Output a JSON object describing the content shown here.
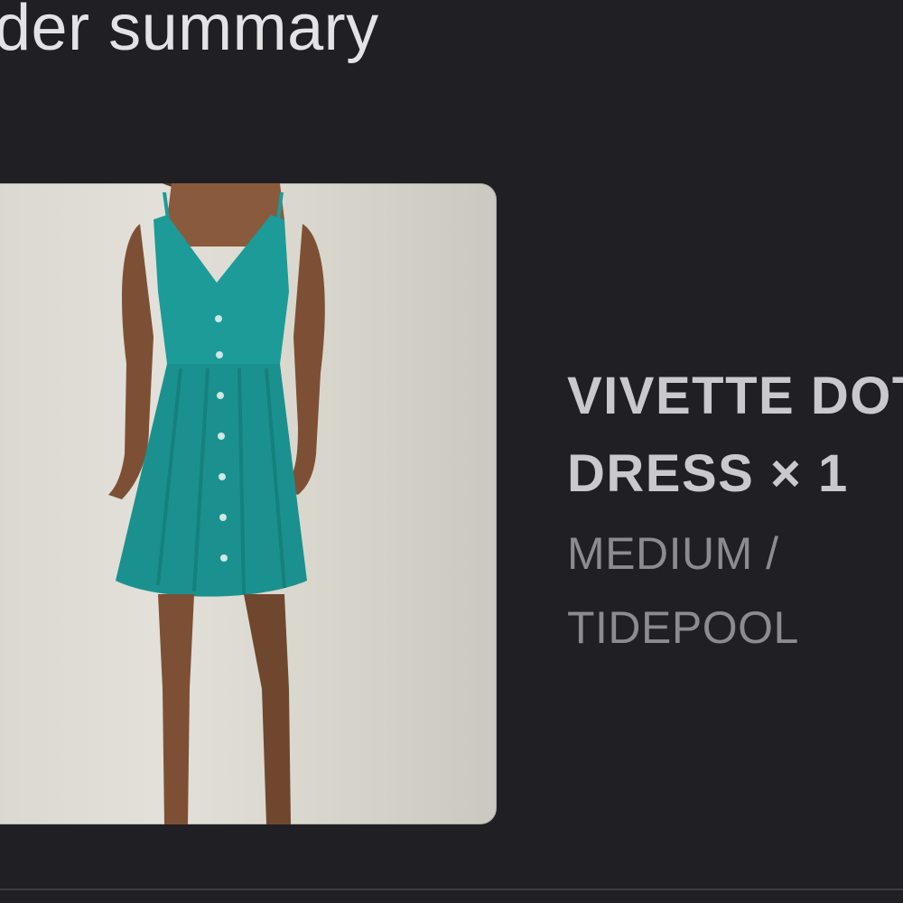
{
  "header": {
    "title": "der summary"
  },
  "line_item": {
    "name_line1": "VIVETTE DOT",
    "name_line2": "DRESS",
    "quantity_text": "× 1",
    "variant_line1": "MEDIUM /",
    "variant_line2": "TIDEPOOL",
    "image_icon": "product-photo-dress"
  },
  "colors": {
    "background": "#1f1f24",
    "dress": "#1c9b98"
  }
}
